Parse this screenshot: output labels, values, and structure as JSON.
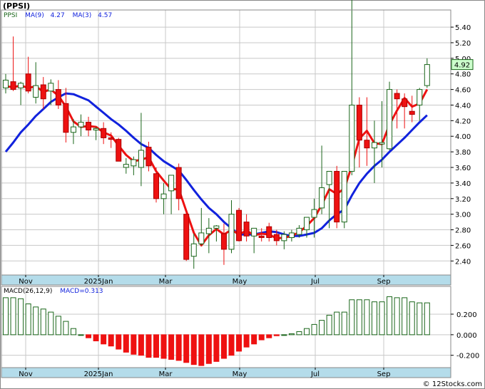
{
  "header": {
    "ticker": "(PPSI)",
    "ma_legend_ticker": "PPSI",
    "ma9_label": "MA(9)",
    "ma9_value": "4.27",
    "ma3_label": "MA(3)",
    "ma3_value": "4.57"
  },
  "macd_legend": {
    "label": "MACD(26,12,9)",
    "value_label": "MACD=0.313"
  },
  "footer": {
    "credit": "© 12Stocks.com"
  },
  "colors": {
    "up_candle": "#1a661a",
    "down_candle": "#ee1111",
    "ma3": "#ee1111",
    "ma9": "#1122dd",
    "axis_strip": "#b4dcea",
    "grid": "#c8c8c8",
    "last_price_box": "#ccffcc"
  },
  "chart_data": [
    {
      "type": "candlestick",
      "title": "(PPSI)",
      "y_ticks": [
        "5.40",
        "5.20",
        "5.00",
        "4.80",
        "4.60",
        "4.40",
        "4.20",
        "4.00",
        "3.80",
        "3.60",
        "3.40",
        "3.20",
        "3.00",
        "2.80",
        "2.60",
        "2.40"
      ],
      "ylim": [
        2.22,
        5.62
      ],
      "x_ticks": [
        "Nov",
        "2025Jan",
        "Mar",
        "May",
        "Jul",
        "Sep"
      ],
      "last_price": "4.92",
      "grid": true,
      "ohlc": [
        [
          4.62,
          4.8,
          4.55,
          4.72
        ],
        [
          4.7,
          5.28,
          4.58,
          4.6
        ],
        [
          4.62,
          4.7,
          4.4,
          4.68
        ],
        [
          4.8,
          5.02,
          4.55,
          4.58
        ],
        [
          4.5,
          4.95,
          4.42,
          4.65
        ],
        [
          4.66,
          4.76,
          4.35,
          4.48
        ],
        [
          4.58,
          4.73,
          4.4,
          4.68
        ],
        [
          4.6,
          4.72,
          4.35,
          4.4
        ],
        [
          4.42,
          4.62,
          3.92,
          4.05
        ],
        [
          4.05,
          4.22,
          3.9,
          4.12
        ],
        [
          4.12,
          4.28,
          4.0,
          4.18
        ],
        [
          4.18,
          4.25,
          4.0,
          4.08
        ],
        [
          4.08,
          4.12,
          3.95,
          4.1
        ],
        [
          4.1,
          4.18,
          3.9,
          3.98
        ],
        [
          3.98,
          4.05,
          3.85,
          3.96
        ],
        [
          3.96,
          3.98,
          3.68,
          3.68
        ],
        [
          3.6,
          3.72,
          3.52,
          3.64
        ],
        [
          3.62,
          3.74,
          3.5,
          3.7
        ],
        [
          3.6,
          4.3,
          3.36,
          3.82
        ],
        [
          3.86,
          3.93,
          3.55,
          3.62
        ],
        [
          3.52,
          3.6,
          3.15,
          3.2
        ],
        [
          3.2,
          3.4,
          3.0,
          3.26
        ],
        [
          3.3,
          3.48,
          3.0,
          3.5
        ],
        [
          3.6,
          3.65,
          3.05,
          3.2
        ],
        [
          3.0,
          3.05,
          2.4,
          2.42
        ],
        [
          2.46,
          2.75,
          2.3,
          2.62
        ],
        [
          2.62,
          3.08,
          2.6,
          2.76
        ],
        [
          2.75,
          2.95,
          2.5,
          2.82
        ],
        [
          2.82,
          2.86,
          2.65,
          2.85
        ],
        [
          2.75,
          2.88,
          2.35,
          2.55
        ],
        [
          2.55,
          3.18,
          2.5,
          3.0
        ],
        [
          3.05,
          3.08,
          2.65,
          2.66
        ],
        [
          2.9,
          3.0,
          2.65,
          2.72
        ],
        [
          2.72,
          2.82,
          2.5,
          2.82
        ],
        [
          2.72,
          2.82,
          2.65,
          2.7
        ],
        [
          2.84,
          2.89,
          2.65,
          2.7
        ],
        [
          2.74,
          2.8,
          2.6,
          2.66
        ],
        [
          2.66,
          2.78,
          2.55,
          2.74
        ],
        [
          2.7,
          2.8,
          2.65,
          2.76
        ],
        [
          2.74,
          2.86,
          2.7,
          2.82
        ],
        [
          2.8,
          2.88,
          2.7,
          2.96
        ],
        [
          2.96,
          3.2,
          2.7,
          3.06
        ],
        [
          3.08,
          3.88,
          3.0,
          3.34
        ],
        [
          3.38,
          3.52,
          2.82,
          3.55
        ],
        [
          3.55,
          3.62,
          2.82,
          2.9
        ],
        [
          2.9,
          3.5,
          2.82,
          3.55
        ],
        [
          3.55,
          5.8,
          3.5,
          4.4
        ],
        [
          4.4,
          4.5,
          3.6,
          3.95
        ],
        [
          3.95,
          4.5,
          3.62,
          3.85
        ],
        [
          3.85,
          4.2,
          3.4,
          3.92
        ],
        [
          3.9,
          4.45,
          3.6,
          3.92
        ],
        [
          3.84,
          4.7,
          3.82,
          4.6
        ],
        [
          4.55,
          4.6,
          4.1,
          4.48
        ],
        [
          4.48,
          4.55,
          4.1,
          4.38
        ],
        [
          4.32,
          4.52,
          4.18,
          4.28
        ],
        [
          4.4,
          4.62,
          4.2,
          4.6
        ],
        [
          4.65,
          5.0,
          4.62,
          4.92
        ]
      ],
      "ma3": [
        4.64,
        4.63,
        4.65,
        4.62,
        4.64,
        4.57,
        4.6,
        4.52,
        4.38,
        4.19,
        4.12,
        4.13,
        4.12,
        4.05,
        4.01,
        3.88,
        3.76,
        3.68,
        3.7,
        3.73,
        3.55,
        3.43,
        3.32,
        3.32,
        3.04,
        2.76,
        2.6,
        2.73,
        2.81,
        2.74,
        2.8,
        2.74,
        2.79,
        2.73,
        2.75,
        2.74,
        2.69,
        2.7,
        2.72,
        2.77,
        2.85,
        2.95,
        3.12,
        3.32,
        3.26,
        3.33,
        3.62,
        3.97,
        4.07,
        3.91,
        3.9,
        4.15,
        4.33,
        4.49,
        4.38,
        4.42,
        4.6
      ],
      "ma9": [
        3.8,
        3.92,
        4.05,
        4.15,
        4.26,
        4.35,
        4.44,
        4.5,
        4.55,
        4.54,
        4.5,
        4.46,
        4.38,
        4.3,
        4.22,
        4.15,
        4.07,
        3.98,
        3.9,
        3.85,
        3.76,
        3.68,
        3.62,
        3.56,
        3.44,
        3.31,
        3.19,
        3.08,
        3.0,
        2.9,
        2.82,
        2.74,
        2.74,
        2.74,
        2.76,
        2.78,
        2.77,
        2.74,
        2.72,
        2.72,
        2.74,
        2.76,
        2.82,
        2.92,
        3.0,
        3.06,
        3.24,
        3.4,
        3.52,
        3.62,
        3.7,
        3.8,
        3.89,
        3.98,
        4.08,
        4.18,
        4.27
      ]
    },
    {
      "type": "bar",
      "title": "MACD(26,12,9)",
      "y_ticks": [
        "0.200",
        "0.000",
        "-0.200"
      ],
      "ylim": [
        -0.32,
        0.47
      ],
      "x_ticks": [
        "Nov",
        "2025Jan",
        "Mar",
        "May",
        "Jul",
        "Sep"
      ],
      "values": [
        0.36,
        0.36,
        0.35,
        0.3,
        0.27,
        0.25,
        0.22,
        0.18,
        0.13,
        0.06,
        0.0,
        -0.03,
        -0.06,
        -0.09,
        -0.11,
        -0.14,
        -0.17,
        -0.19,
        -0.2,
        -0.22,
        -0.22,
        -0.23,
        -0.24,
        -0.25,
        -0.27,
        -0.29,
        -0.3,
        -0.28,
        -0.26,
        -0.23,
        -0.2,
        -0.16,
        -0.12,
        -0.09,
        -0.05,
        -0.03,
        -0.01,
        0.0,
        0.01,
        0.03,
        0.06,
        0.1,
        0.14,
        0.19,
        0.22,
        0.22,
        0.34,
        0.34,
        0.34,
        0.32,
        0.32,
        0.37,
        0.36,
        0.36,
        0.32,
        0.31,
        0.31
      ]
    }
  ]
}
